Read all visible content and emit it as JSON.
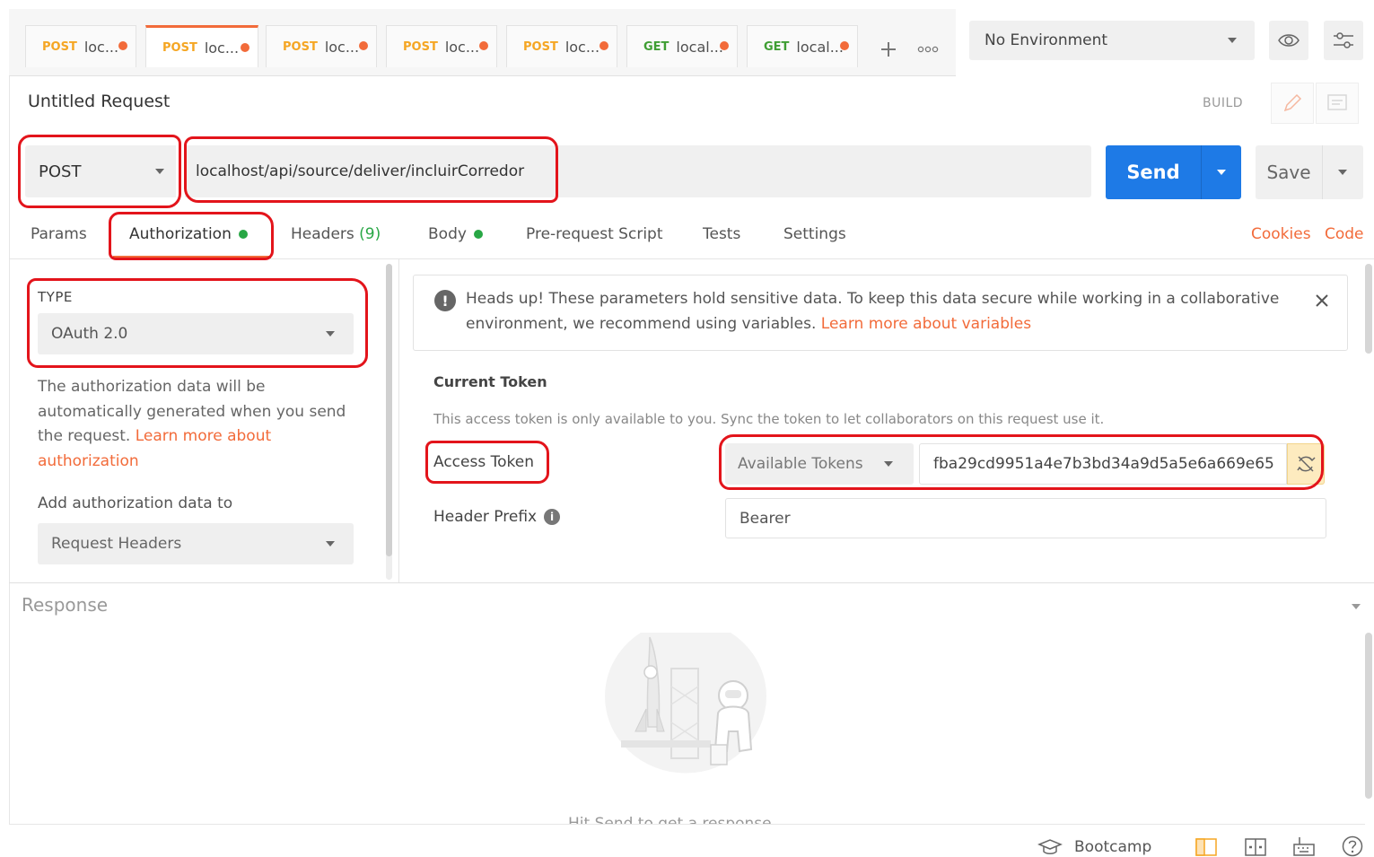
{
  "tabs": [
    {
      "method": "POST",
      "label": "loc...",
      "active": false
    },
    {
      "method": "POST",
      "label": "loc...",
      "active": true
    },
    {
      "method": "POST",
      "label": "loc...",
      "active": false
    },
    {
      "method": "POST",
      "label": "loc...",
      "active": false
    },
    {
      "method": "POST",
      "label": "loc...",
      "active": false
    },
    {
      "method": "GET",
      "label": "local...",
      "active": false
    },
    {
      "method": "GET",
      "label": "local...",
      "active": false
    }
  ],
  "toolbar": {
    "environment": "No Environment",
    "new_tab_icon": "plus-icon",
    "more_tabs_icon": "ellipsis-icon",
    "eye_icon": "eye-icon",
    "settings_icon": "sliders-icon"
  },
  "request": {
    "title": "Untitled Request",
    "mode": "BUILD",
    "method": "POST",
    "url": "localhost/api/source/deliver/incluirCorredor",
    "send_label": "Send",
    "save_label": "Save"
  },
  "subtabs": {
    "params": "Params",
    "authorization": "Authorization",
    "headers": "Headers",
    "headers_count": "(9)",
    "body": "Body",
    "prerequest": "Pre-request Script",
    "tests": "Tests",
    "settings": "Settings",
    "cookies": "Cookies",
    "code": "Code"
  },
  "auth": {
    "type_label": "TYPE",
    "type_value": "OAuth 2.0",
    "description": "The authorization data will be automatically generated when you send the request.",
    "learn_more": "Learn more about authorization",
    "add_to_label": "Add authorization data to",
    "add_to_value": "Request Headers"
  },
  "notice": {
    "text": "Heads up! These parameters hold sensitive data. To keep this data secure while working in a collaborative environment, we recommend using variables.",
    "link": "Learn more about variables"
  },
  "token": {
    "heading": "Current Token",
    "help": "This access token is only available to you. Sync the token to let collaborators on this request use it.",
    "access_label": "Access Token",
    "available_label": "Available Tokens",
    "value": "fba29cd9951a4e7b3bd34a9d5a5e6a669e65",
    "prefix_label": "Header Prefix",
    "prefix_value": "Bearer"
  },
  "response": {
    "title": "Response",
    "hint": "Hit Send to get a response"
  },
  "footer": {
    "bootcamp": "Bootcamp"
  },
  "colors": {
    "accent": "#f26b3a",
    "send": "#1e7ae6",
    "post": "#f5a623",
    "get": "#3f9e33",
    "highlight": "#e3141b"
  }
}
